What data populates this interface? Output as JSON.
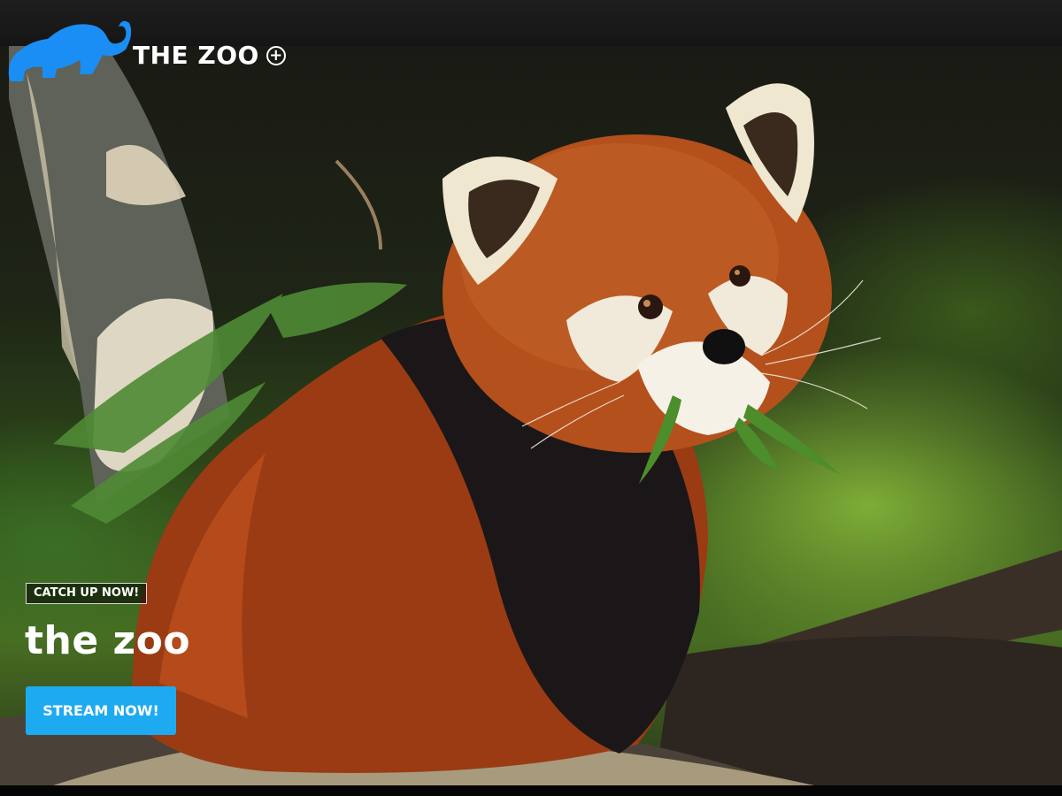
{
  "header": {
    "brand_title": "THE ZOO",
    "plus_symbol": "+",
    "logo_icon": "elephant-logo-icon",
    "plus_icon": "plus-circle-icon",
    "logo_color": "#1a8ef5"
  },
  "hero": {
    "image_subject": "red-panda-photo",
    "badge_label": "CATCH UP NOW!",
    "show_title": "the zoo",
    "cta_label": "STREAM NOW!",
    "cta_color": "#1eaaf1"
  }
}
